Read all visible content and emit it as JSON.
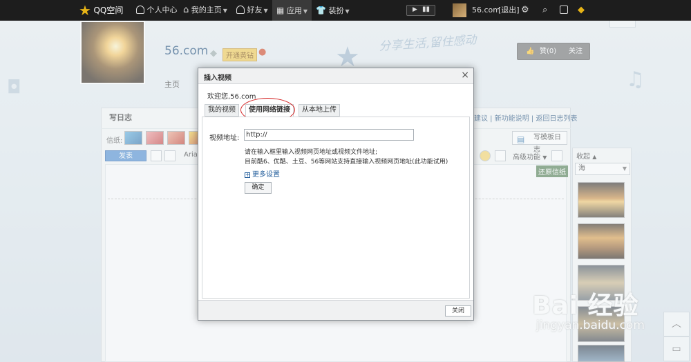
{
  "topbar": {
    "logo": "QQ空间",
    "items": [
      "个人中心",
      "我的主页",
      "好友",
      "应用",
      "装扮"
    ],
    "username": "56.com",
    "logout": "[退出]"
  },
  "profile": {
    "site_name": "56.com",
    "vip_label": "开通黄钻",
    "nav_home": "主页",
    "slogan": "分享生活,留住感动",
    "like_count": "赞(0)",
    "like_extra": "关注"
  },
  "editor": {
    "title": "写日志",
    "paper_label": "信纸:",
    "publish": "发表",
    "font": "Arial",
    "right_links": "建议 | 新功能说明 | 返回日志列表",
    "template_btn": "写模板日志",
    "advanced": "高级功能",
    "restore": "还原信纸"
  },
  "sidebar": {
    "collapse": "收起",
    "search_value": "海"
  },
  "dialog": {
    "title": "插入视频",
    "welcome": "欢迎您,56.com",
    "tabs": [
      "我的视频",
      "使用网络链接",
      "从本地上传"
    ],
    "field_label": "视频地址:",
    "url_value": "http://",
    "hint1": "请在输入框里输入视频网页地址或视频文件地址;",
    "hint2": "目前酷6、优酷、土豆、56等网站支持直接输入视频网页地址(此功能试用)",
    "more_settings": "更多设置",
    "confirm": "确定",
    "close": "关闭"
  },
  "watermark": {
    "brand": "Bai 经验",
    "url": "jingyan.baidu.com"
  },
  "colors": {
    "topbar": "#1d1d1d",
    "highlight_circle": "#d42323",
    "link_blue": "#1f5b9a"
  }
}
